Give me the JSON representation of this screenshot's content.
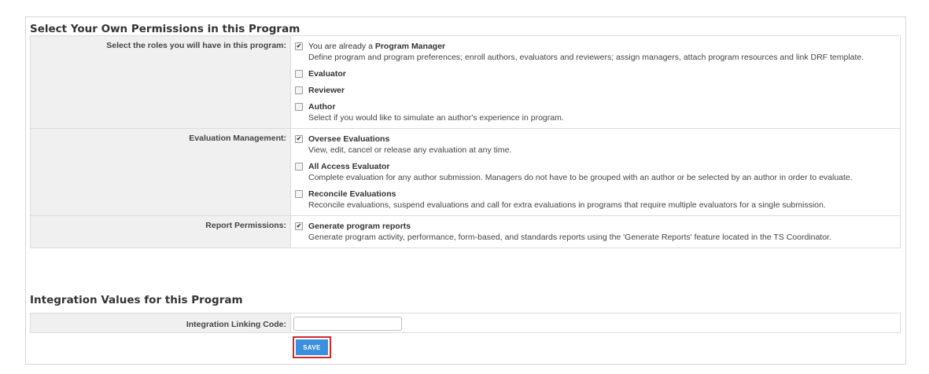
{
  "permissions_section": {
    "title": "Select Your Own Permissions in this Program",
    "groups": [
      {
        "label": "Select the roles you will have in this program:",
        "options": [
          {
            "prefix": "You are already a ",
            "title": "Program Manager",
            "checked": true,
            "description": "Define program and program preferences; enroll authors, evaluators and reviewers; assign managers, attach program resources and link DRF template."
          },
          {
            "title": "Evaluator",
            "checked": false
          },
          {
            "title": "Reviewer",
            "checked": false
          },
          {
            "title": "Author",
            "checked": false,
            "description": "Select if you would like to simulate an author's experience in program."
          }
        ]
      },
      {
        "label": "Evaluation Management:",
        "options": [
          {
            "title": "Oversee Evaluations",
            "checked": true,
            "description": "View, edit, cancel or release any evaluation at any time."
          },
          {
            "title": "All Access Evaluator",
            "checked": false,
            "description": "Complete evaluation for any author submission. Managers do not have to be grouped with an author or be selected by an author in order to evaluate."
          },
          {
            "title": "Reconcile Evaluations",
            "checked": false,
            "description": "Reconcile evaluations, suspend evaluations and call for extra evaluations in programs that require multiple evaluators for a single submission."
          }
        ]
      },
      {
        "label": "Report Permissions:",
        "options": [
          {
            "title": "Generate program reports",
            "checked": true,
            "description": "Generate program activity, performance, form-based, and standards reports using the 'Generate Reports' feature located in the TS Coordinator."
          }
        ]
      }
    ]
  },
  "integration_section": {
    "title": "Integration Values for this Program",
    "field_label": "Integration Linking Code:",
    "field_value": ""
  },
  "save_label": "SAVE",
  "check_glyph": "✔"
}
